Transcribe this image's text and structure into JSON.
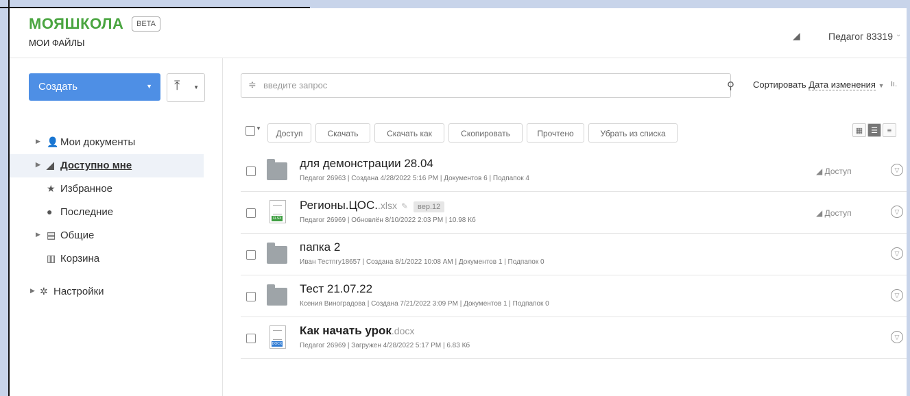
{
  "header": {
    "logo": "МОЯШКОЛА",
    "beta": "BETA",
    "section": "МОИ ФАЙЛЫ",
    "user": "Педагог 83319",
    "user_caret": "⌄"
  },
  "sidebar": {
    "create_label": "Создать",
    "create_caret": "▼",
    "upload_icon": "⤒",
    "upload_caret": "▼",
    "items": [
      {
        "label": "Мои документы",
        "icon": "user-icon",
        "glyph": "👤"
      },
      {
        "label": "Доступно мне",
        "icon": "share-icon",
        "glyph": "◢"
      },
      {
        "label": "Избранное",
        "icon": "star-icon",
        "glyph": "★"
      },
      {
        "label": "Последние",
        "icon": "clock-icon",
        "glyph": "●"
      },
      {
        "label": "Общие",
        "icon": "shared-drive-icon",
        "glyph": "▤"
      },
      {
        "label": "Корзина",
        "icon": "trash-icon",
        "glyph": "▥"
      },
      {
        "label": "Настройки",
        "icon": "gear-icon",
        "glyph": "✲"
      }
    ]
  },
  "search": {
    "placeholder": "введите запрос",
    "filter_icon": "≑",
    "search_icon": "🔍"
  },
  "sort": {
    "label": "Сортировать",
    "key": "Дата изменения",
    "caret": "▼",
    "icon": "Iı."
  },
  "toolbar": {
    "caret": "▼",
    "buttons": [
      "Доступ",
      "Скачать",
      "Скачать как",
      "Скопировать",
      "Прочтено",
      "Убрать из списка"
    ],
    "views": [
      "▦",
      "☰",
      "≡"
    ]
  },
  "files": [
    {
      "name": "для демонстрации 28.04",
      "ext": "",
      "type": "folder",
      "meta": "Педагог 26963 | Создана 4/28/2022 5:16 PM | Документов 6 | Подпапок 4",
      "access": "Доступ"
    },
    {
      "name": "Регионы.ЦОС.",
      "ext": ".xlsx",
      "type": "xlsx",
      "tag": "XLSX",
      "version": "вер.12",
      "meta": "Педагог 26969 | Обновлён 8/10/2022 2:03 PM | 10.98 Кб",
      "access": "Доступ"
    },
    {
      "name": "папка 2",
      "ext": "",
      "type": "folder",
      "meta": "Иван Тестпгу18657 | Создана 8/1/2022 10:08 AM | Документов 1 | Подпапок 0",
      "access": ""
    },
    {
      "name": "Тест 21.07.22",
      "ext": "",
      "type": "folder",
      "meta": "Ксения Виноградова | Создана 7/21/2022 3:09 PM | Документов 1 | Подпапок 0",
      "access": ""
    },
    {
      "name": "Как начать урок",
      "ext": ".docx",
      "type": "docx",
      "tag": "DOCX",
      "meta": "Педагог 26969 | Загружен 4/28/2022 5:17 PM | 6.83 Кб",
      "access": ""
    }
  ],
  "colors": {
    "accent": "#4e8fe5",
    "brand": "#4aa540",
    "xlsx": "#3f9f42",
    "docx": "#2f7bd3"
  }
}
